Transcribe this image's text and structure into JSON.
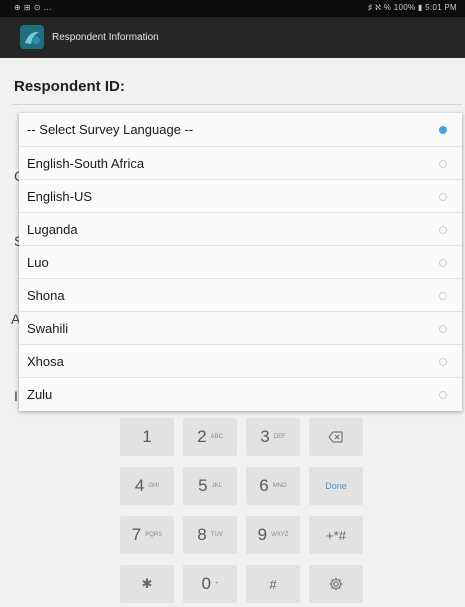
{
  "status": {
    "left_text": "⊕ ⊞ ⊙ ...",
    "right_text": "♯ ℵ % 100% ▮ 5:01 PM"
  },
  "header": {
    "title": "Respondent Information"
  },
  "form": {
    "respondent_label": "Respondent ID:"
  },
  "peek": [
    "C",
    "S",
    "A",
    "I"
  ],
  "language_popup": {
    "options": [
      {
        "label": "-- Select Survey Language --",
        "selected": true
      },
      {
        "label": "English-South Africa",
        "selected": false
      },
      {
        "label": "English-US",
        "selected": false
      },
      {
        "label": "Luganda",
        "selected": false
      },
      {
        "label": "Luo",
        "selected": false
      },
      {
        "label": "Shona",
        "selected": false
      },
      {
        "label": "Swahili",
        "selected": false
      },
      {
        "label": "Xhosa",
        "selected": false
      },
      {
        "label": "Zulu",
        "selected": false
      }
    ]
  },
  "keypad": {
    "rows": [
      [
        {
          "main": "1",
          "sub": ""
        },
        {
          "main": "2",
          "sub": "ABC"
        },
        {
          "main": "3",
          "sub": "DEF"
        },
        {
          "icon": "backspace-icon"
        }
      ],
      [
        {
          "main": "4",
          "sub": "GHI"
        },
        {
          "main": "5",
          "sub": "JKL"
        },
        {
          "main": "6",
          "sub": "MNO"
        },
        {
          "fn": "Done"
        }
      ],
      [
        {
          "main": "7",
          "sub": "PQRS"
        },
        {
          "main": "8",
          "sub": "TUV"
        },
        {
          "main": "9",
          "sub": "WXYZ"
        },
        {
          "sym": "+*#"
        }
      ],
      [
        {
          "sym": "✱"
        },
        {
          "main": "0",
          "sub": "+"
        },
        {
          "sym": "#"
        },
        {
          "icon": "gear-icon"
        }
      ]
    ]
  },
  "colors": {
    "accent": "#4aa3df",
    "actionbar": "#262626",
    "statusbar": "#0d0d0d"
  }
}
